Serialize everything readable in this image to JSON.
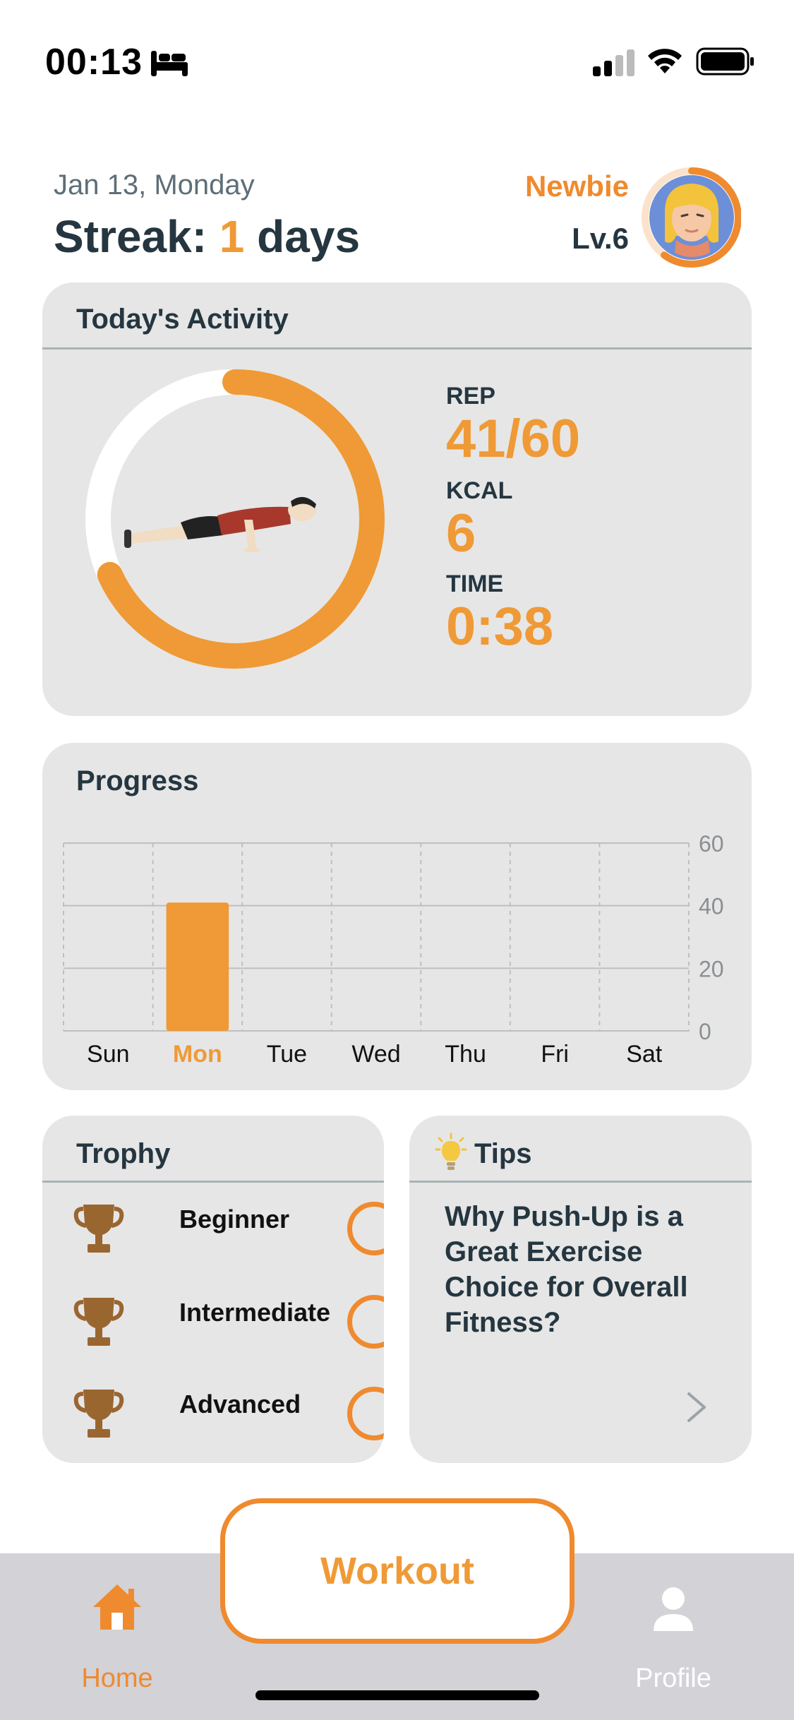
{
  "status_bar": {
    "time": "00:13",
    "icons": [
      "bed-icon",
      "cellular-signal-icon",
      "wifi-icon",
      "battery-icon"
    ]
  },
  "header": {
    "date": "Jan 13, Monday",
    "streak_prefix": "Streak: ",
    "streak_count": "1",
    "streak_suffix": " days",
    "rank": "Newbie",
    "level": "Lv.6",
    "avatar_progress": 0.6
  },
  "activity": {
    "title": "Today's Activity",
    "rep_label": "REP",
    "rep_value": "41/60",
    "rep_progress": 0.683,
    "kcal_label": "KCAL",
    "kcal_value": "6",
    "time_label": "TIME",
    "time_value": "0:38",
    "illustration": "push-up-figure"
  },
  "progress": {
    "title": "Progress",
    "highlight_day": "Mon"
  },
  "chart_data": {
    "type": "bar",
    "categories": [
      "Sun",
      "Mon",
      "Tue",
      "Wed",
      "Thu",
      "Fri",
      "Sat"
    ],
    "values": [
      0,
      41,
      0,
      0,
      0,
      0,
      0
    ],
    "ylim": [
      0,
      60
    ],
    "yticks": [
      "0",
      "20",
      "40",
      "60"
    ],
    "grid": true,
    "bar_color": "#ef9a36"
  },
  "trophy": {
    "title": "Trophy",
    "items": [
      {
        "label": "Beginner"
      },
      {
        "label": "Intermediate"
      },
      {
        "label": "Advanced"
      }
    ]
  },
  "tips": {
    "title": "Tips",
    "text": "Why Push-Up is a Great Exercise Choice for Overall Fitness?"
  },
  "nav": {
    "home_label": "Home",
    "workout_label": "Workout",
    "profile_label": "Profile"
  },
  "colors": {
    "accent": "#ef9a36",
    "accent_dark": "#ef8a2e",
    "text_dark": "#253640",
    "card_bg": "#e6e6e6",
    "tab_bar_bg": "#d2d2d7"
  }
}
